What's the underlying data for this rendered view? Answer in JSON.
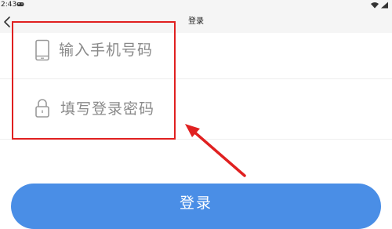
{
  "status_bar": {
    "time": "2:43",
    "icons": [
      "gamepad-icon",
      "wifi-icon",
      "signal-icon"
    ]
  },
  "header": {
    "title": "登录",
    "back_icon": "chevron-left-icon"
  },
  "form": {
    "phone_placeholder": "输入手机号码",
    "phone_icon": "phone-icon",
    "password_placeholder": "填写登录密码",
    "password_icon": "lock-icon"
  },
  "login_button": {
    "label": "登录"
  },
  "annotation": {
    "box_color": "#e02020",
    "arrow_color": "#e02020"
  },
  "colors": {
    "accent": "#4a8ee6",
    "placeholder": "#8a8a8a"
  }
}
